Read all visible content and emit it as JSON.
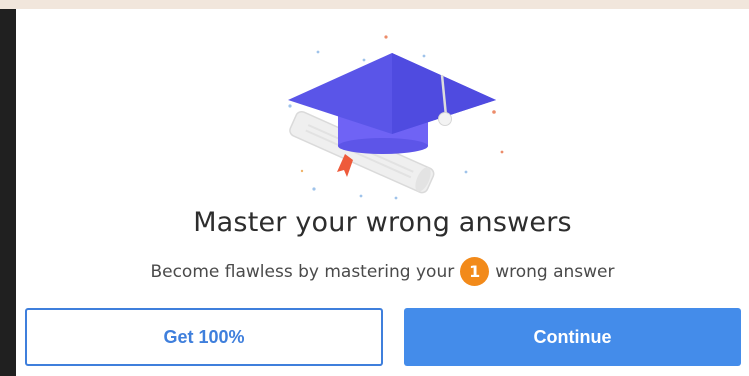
{
  "modal": {
    "title": "Master your wrong answers",
    "subtitle_before": "Become flawless by mastering your",
    "wrong_count": "1",
    "subtitle_after": "wrong answer"
  },
  "buttons": {
    "get_label": "Get 100%",
    "continue_label": "Continue"
  },
  "colors": {
    "primary": "#448cea",
    "outline": "#3f7fdc",
    "badge": "#f28a1a",
    "cap": "#5a55e8"
  },
  "icons": {
    "hero": "graduation-cap-icon"
  }
}
